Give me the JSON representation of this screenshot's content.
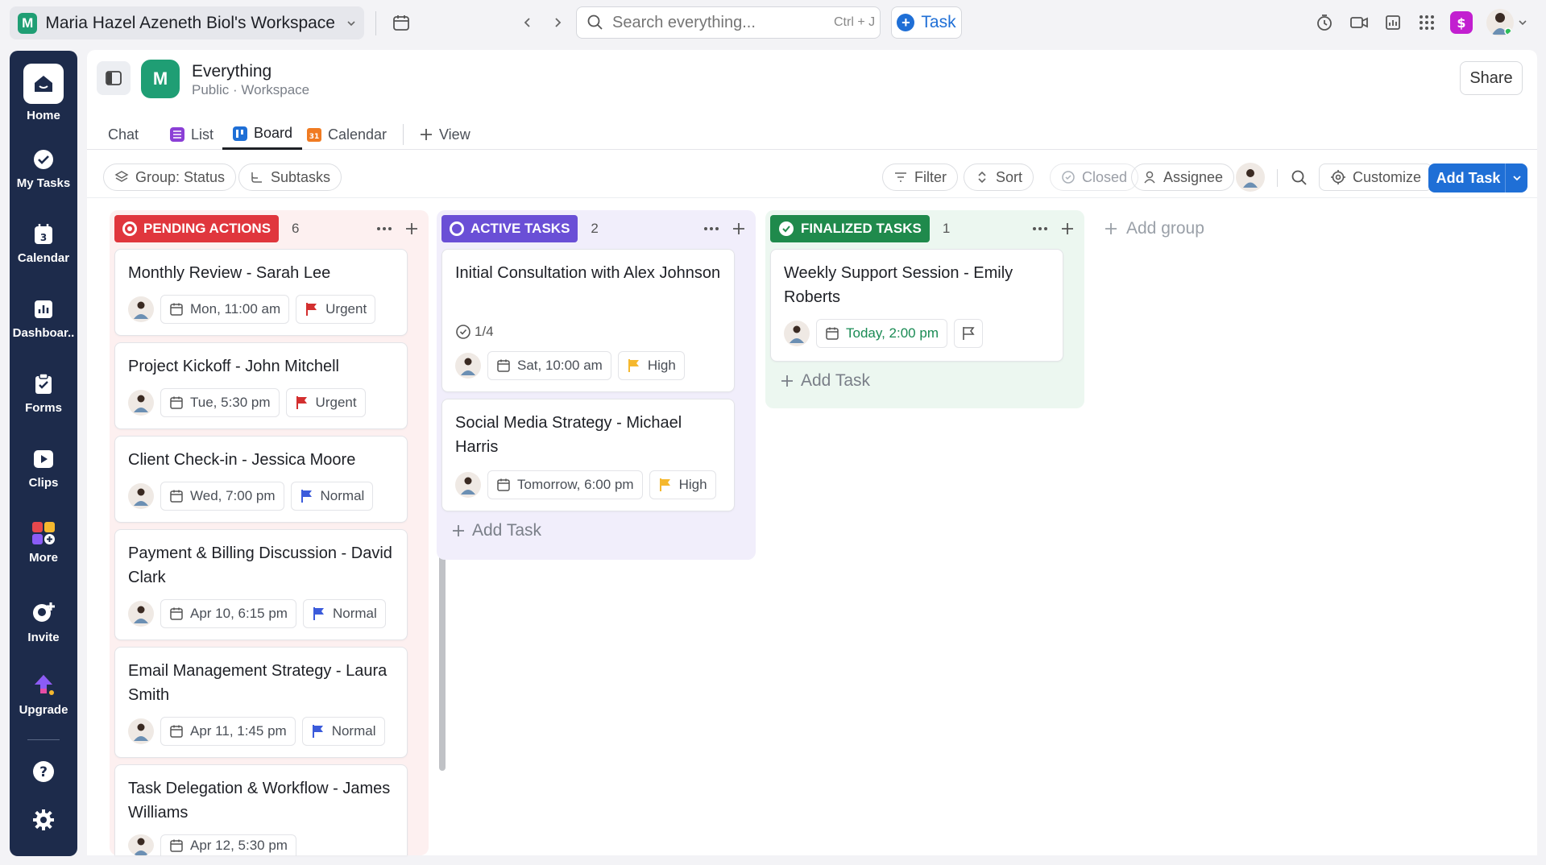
{
  "topbar": {
    "workspace_logo": "M",
    "workspace_name": "Maria Hazel Azeneth Biol's Workspace",
    "search_placeholder": "Search everything...",
    "search_shortcut": "Ctrl + J",
    "task_label": "Task"
  },
  "sidebar": {
    "items": [
      {
        "label": "Home",
        "icon": "home-icon"
      },
      {
        "label": "My Tasks",
        "icon": "check-circle-icon"
      },
      {
        "label": "Calendar",
        "icon": "calendar-icon",
        "badge": "3"
      },
      {
        "label": "Dashboar..",
        "icon": "dashboard-icon"
      },
      {
        "label": "Forms",
        "icon": "forms-icon"
      },
      {
        "label": "Clips",
        "icon": "clips-icon"
      },
      {
        "label": "More",
        "icon": "apps-icon"
      },
      {
        "label": "Invite",
        "icon": "invite-icon"
      },
      {
        "label": "Upgrade",
        "icon": "upgrade-icon"
      }
    ]
  },
  "header": {
    "space_logo": "M",
    "title": "Everything",
    "subtitle": "Public · Workspace",
    "share_label": "Share"
  },
  "tabs": [
    {
      "label": "Chat"
    },
    {
      "label": "List"
    },
    {
      "label": "Board"
    },
    {
      "label": "Calendar"
    },
    {
      "label": "View"
    }
  ],
  "calendar_tab_icon_text": "31",
  "toolbar": {
    "group_status": "Group: Status",
    "subtasks": "Subtasks",
    "filter": "Filter",
    "sort": "Sort",
    "closed": "Closed",
    "assignee": "Assignee",
    "customize": "Customize",
    "add_task": "Add Task"
  },
  "colors": {
    "pending": "#e0363d",
    "active": "#6a4fd6",
    "finalized": "#1f8a4c",
    "urgent_flag": "#d32f2f",
    "high_flag": "#f5b82e",
    "normal_flag": "#3b5bdb",
    "primary": "#1f6fd6"
  },
  "board": {
    "columns": [
      {
        "status": "PENDING ACTIONS",
        "count": "6",
        "cards": [
          {
            "title": "Monthly Review - Sarah Lee",
            "date": "Mon, 11:00 am",
            "priority": "Urgent"
          },
          {
            "title": "Project Kickoff - John Mitchell",
            "date": "Tue, 5:30 pm",
            "priority": "Urgent"
          },
          {
            "title": "Client Check-in - Jessica Moore",
            "date": "Wed, 7:00 pm",
            "priority": "Normal"
          },
          {
            "title": "Payment & Billing Discussion - David Clark",
            "date": "Apr 10, 6:15 pm",
            "priority": "Normal"
          },
          {
            "title": "Email Management Strategy - Laura Smith",
            "date": "Apr 11, 1:45 pm",
            "priority": "Normal"
          },
          {
            "title": "Task Delegation & Workflow - James Williams",
            "date": "Apr 12, 5:30 pm",
            "priority": ""
          }
        ]
      },
      {
        "status": "ACTIVE TASKS",
        "count": "2",
        "add_task": "Add Task",
        "cards": [
          {
            "title": "Initial Consultation with Alex Johnson",
            "subtasks": "1/4",
            "date": "Sat, 10:00 am",
            "priority": "High"
          },
          {
            "title": "Social Media Strategy - Michael Harris",
            "date": "Tomorrow, 6:00 pm",
            "priority": "High"
          }
        ]
      },
      {
        "status": "FINALIZED TASKS",
        "count": "1",
        "add_task": "Add Task",
        "cards": [
          {
            "title": "Weekly Support Session - Emily Roberts",
            "date": "Today, 2:00 pm",
            "priority": ""
          }
        ]
      }
    ],
    "add_group": "Add group"
  }
}
